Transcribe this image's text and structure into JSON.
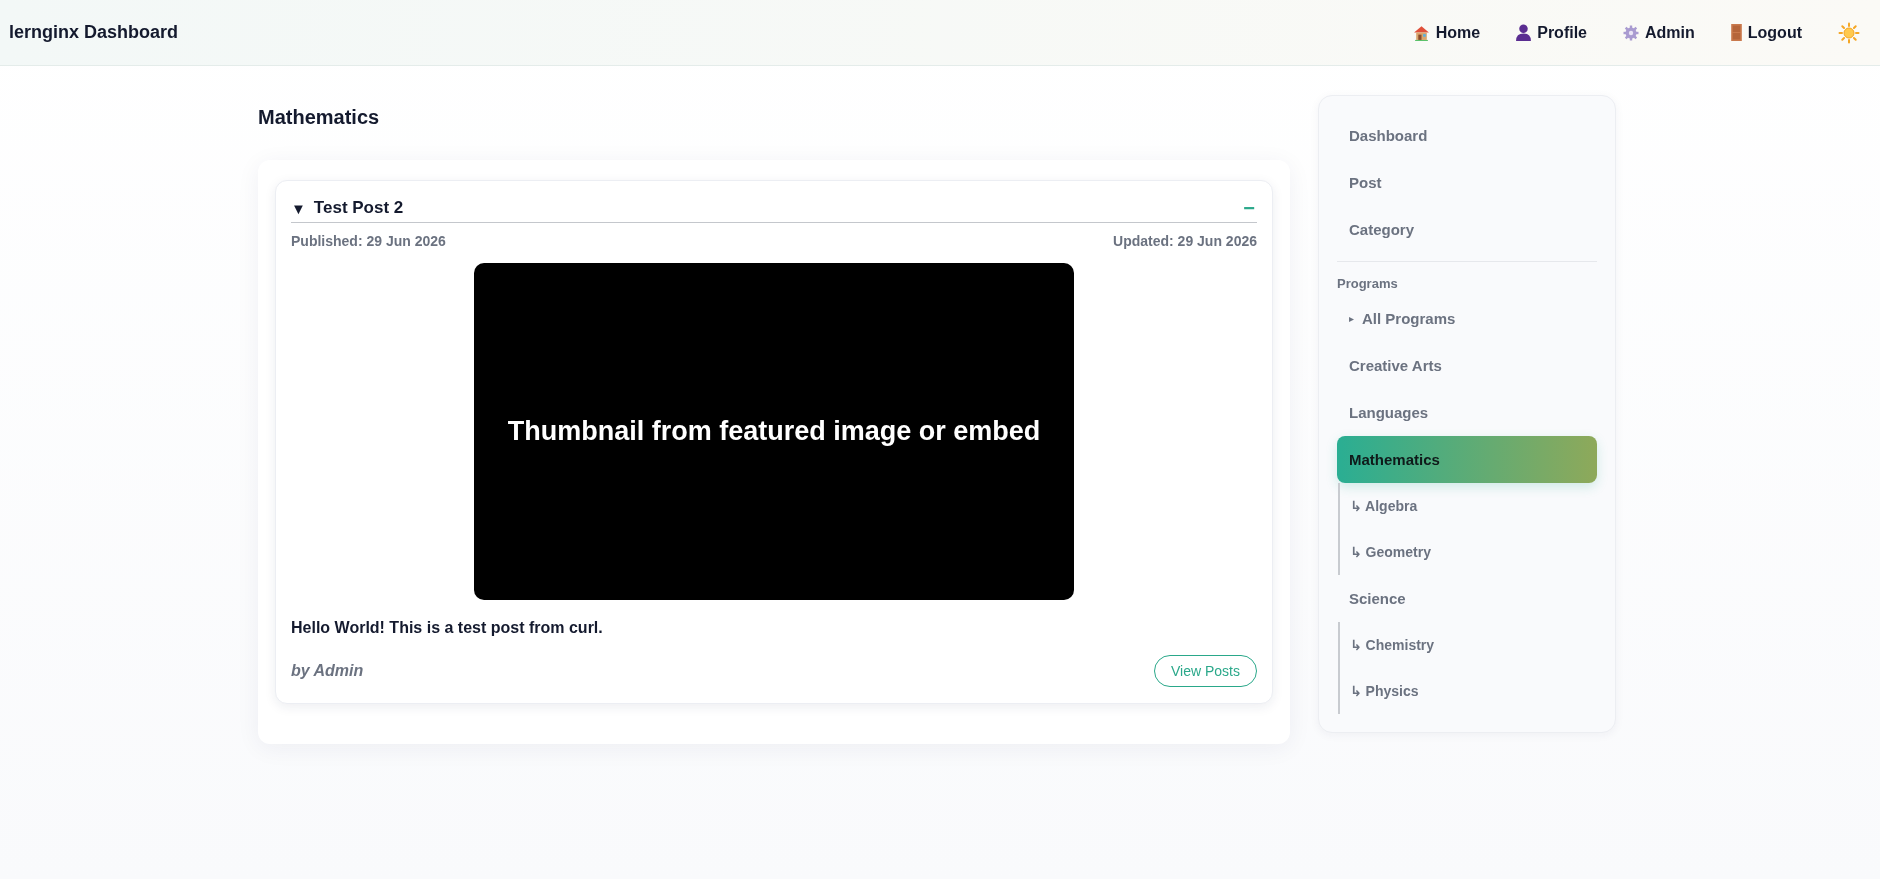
{
  "header": {
    "title": "lernginx Dashboard",
    "nav": [
      {
        "label": "Home"
      },
      {
        "label": "Profile"
      },
      {
        "label": "Admin"
      },
      {
        "label": "Logout"
      }
    ]
  },
  "page_title": "Mathematics",
  "post": {
    "toggle": "▼",
    "title": "Test Post 2",
    "collapse": "−",
    "published": "Published: 29 Jun 2026",
    "updated": "Updated: 29 Jun 2026",
    "thumbnail": "Thumbnail from featured image or embed",
    "body": "Hello World! This is a test post from curl.",
    "author": "by Admin",
    "button": "View Posts"
  },
  "sidebar": {
    "top": [
      {
        "label": "Dashboard",
        "selected": false
      },
      {
        "label": "Post",
        "selected": false
      },
      {
        "label": "Category",
        "selected": false
      }
    ],
    "section": "Programs",
    "programs": [
      {
        "kind": "toggle",
        "marker": "▸",
        "label": "All Programs",
        "selected": false
      },
      {
        "kind": "link",
        "label": "Creative Arts",
        "selected": false
      },
      {
        "kind": "link",
        "label": "Languages",
        "selected": false
      },
      {
        "kind": "link",
        "label": "Mathematics",
        "selected": true,
        "children": [
          {
            "label": "↳ Algebra",
            "selected": false
          },
          {
            "label": "↳ Geometry",
            "selected": false
          }
        ]
      },
      {
        "kind": "link",
        "label": "Science",
        "selected": false,
        "children": [
          {
            "label": "↳ Chemistry",
            "selected": false
          },
          {
            "label": "↳ Physics",
            "selected": false
          }
        ]
      }
    ]
  }
}
